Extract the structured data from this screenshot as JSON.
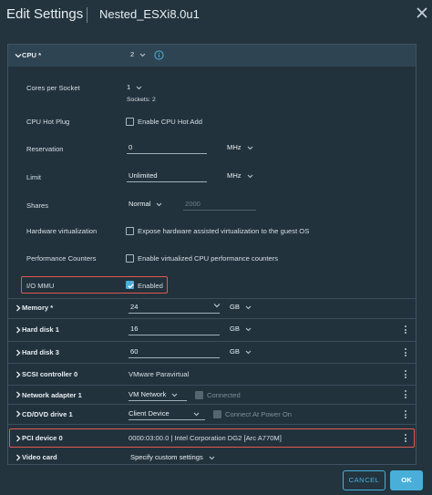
{
  "dialog": {
    "title": "Edit Settings",
    "vm_name": "Nested_ESXi8.0u1"
  },
  "colors": {
    "accent": "#49afd9",
    "highlight": "#e05a4e",
    "background": "#23343f"
  },
  "cpu": {
    "label": "CPU *",
    "value": "2",
    "cores_per_socket": {
      "label": "Cores per Socket",
      "value": "1",
      "note": "Sockets: 2"
    },
    "hot_plug": {
      "label": "CPU Hot Plug",
      "checkbox_label": "Enable CPU Hot Add",
      "checked": false
    },
    "reservation": {
      "label": "Reservation",
      "value": "0",
      "unit": "MHz"
    },
    "limit": {
      "label": "Limit",
      "value": "Unlimited",
      "unit": "MHz"
    },
    "shares": {
      "label": "Shares",
      "level": "Normal",
      "value": "2000"
    },
    "hw_virt": {
      "label": "Hardware virtualization",
      "checkbox_label": "Expose hardware assisted virtualization to the guest OS",
      "checked": false
    },
    "perf_counters": {
      "label": "Performance Counters",
      "checkbox_label": "Enable virtualized CPU performance counters",
      "checked": false
    },
    "iommu": {
      "label": "I/O MMU",
      "checkbox_label": "Enabled",
      "checked": true
    }
  },
  "memory": {
    "label": "Memory *",
    "value": "24",
    "unit": "GB"
  },
  "hard_disk_1": {
    "label": "Hard disk 1",
    "value": "16",
    "unit": "GB"
  },
  "hard_disk_3": {
    "label": "Hard disk 3",
    "value": "60",
    "unit": "GB"
  },
  "scsi": {
    "label": "SCSI controller 0",
    "value": "VMware Paravirtual"
  },
  "network": {
    "label": "Network adapter 1",
    "value": "VM Network",
    "connected_label": "Connected",
    "connected": false
  },
  "cdrom": {
    "label": "CD/DVD drive 1",
    "value": "Client Device",
    "connect_label": "Connect At Power On",
    "connect": false
  },
  "pci": {
    "label": "PCI device 0",
    "value": "0000:03:00.0 | Intel Corporation DG2 [Arc A770M]"
  },
  "video": {
    "label": "Video card",
    "value": "Specify custom settings"
  },
  "footer": {
    "cancel": "CANCEL",
    "ok": "OK"
  }
}
